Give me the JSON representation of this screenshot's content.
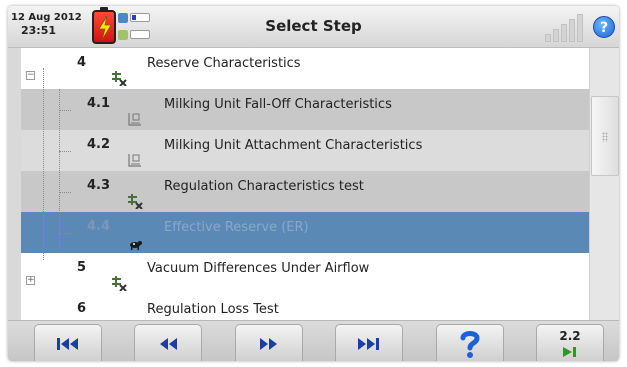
{
  "header": {
    "date": "12 Aug 2012",
    "time": "23:51",
    "title": "Select Step",
    "help_symbol": "?"
  },
  "steps": [
    {
      "number": "4",
      "label": "Reserve Characteristics",
      "icon": "tools-icon",
      "state": "normal"
    },
    {
      "number": "4.1",
      "label": "Milking Unit Fall-Off Characteristics",
      "icon": "procedure-icon",
      "state": "completed"
    },
    {
      "number": "4.2",
      "label": "Milking Unit Attachment Characteristics",
      "icon": "procedure-icon",
      "state": "completed"
    },
    {
      "number": "4.3",
      "label": "Regulation Characteristics test",
      "icon": "tools-icon",
      "state": "completed"
    },
    {
      "number": "4.4",
      "label": "Effective Reserve (ER)",
      "icon": "cow-icon",
      "state": "selected"
    },
    {
      "number": "5",
      "label": "Vacuum Differences Under Airflow",
      "icon": "tools-icon",
      "state": "normal"
    },
    {
      "number": "6",
      "label": "Regulation Loss Test",
      "icon": "tools-icon",
      "state": "normal"
    }
  ],
  "toolbar": {
    "current_step": "2.2",
    "buttons": [
      "first-button",
      "previous-button",
      "next-button",
      "last-button",
      "help-button",
      "current-step-button"
    ]
  },
  "colors": {
    "selected_row": "#5a89b6",
    "completed_row_dark": "#c8c8c8",
    "completed_row_light": "#dcdcdc",
    "nav_icon": "#1a3f9c",
    "help_icon": "#1a63d6",
    "step_arrow": "#1fa11f"
  }
}
